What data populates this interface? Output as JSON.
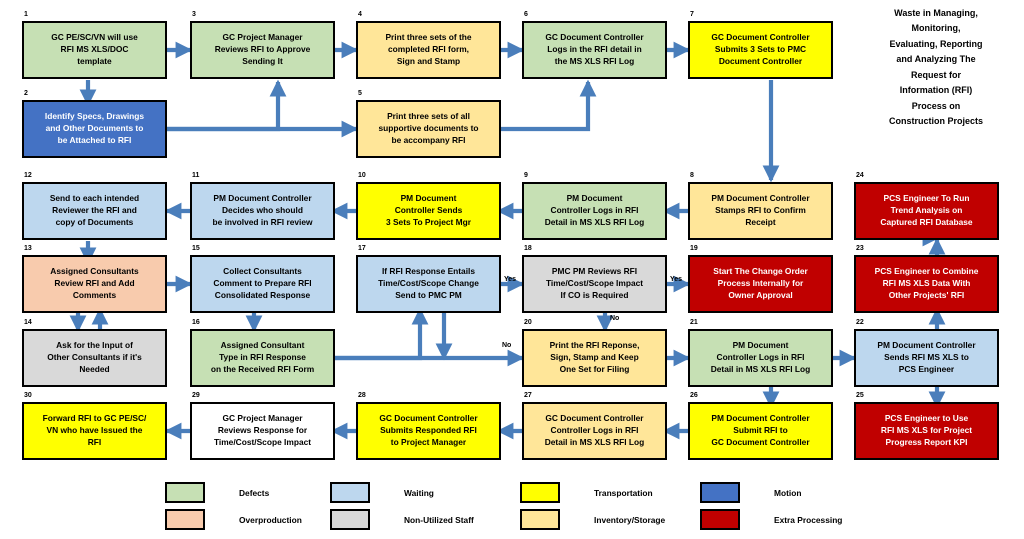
{
  "title": {
    "lines": [
      "Waste in Managing,",
      "Monitoring,",
      "Evaluating, Reporting",
      "and Analyzing The",
      "Request for",
      "Information (RFI)",
      "Process on",
      "Construction Projects"
    ]
  },
  "colors": {
    "defects": "#c6e0b4",
    "overproduction": "#f8cbad",
    "waiting": "#bdd7ee",
    "non_utilized_staff": "#d9d9d9",
    "transportation": "#ffff00",
    "inventory_storage": "#ffe699",
    "motion": "#4472c4",
    "extra_processing": "#c00000",
    "white": "#ffffff",
    "arrow": "#4a7ebb",
    "border": "#000000"
  },
  "nodes": [
    {
      "num": "1",
      "lines": [
        "GC PE/SC/VN will use",
        "RFI MS XLS/DOC",
        "template"
      ],
      "fill": "defects",
      "light": false
    },
    {
      "num": "2",
      "lines": [
        "Identify Specs, Drawings",
        "and Other Documents to",
        "be Attached to RFI"
      ],
      "fill": "motion",
      "light": true
    },
    {
      "num": "3",
      "lines": [
        "GC Project Manager",
        "Reviews RFI to Approve",
        "Sending It"
      ],
      "fill": "defects",
      "light": false
    },
    {
      "num": "4",
      "lines": [
        "Print three sets of the",
        "completed RFI form,",
        "Sign and Stamp"
      ],
      "fill": "inventory_storage",
      "light": false
    },
    {
      "num": "5",
      "lines": [
        "Print three sets of all",
        "supportive documents to",
        "be accompany RFI"
      ],
      "fill": "inventory_storage",
      "light": false
    },
    {
      "num": "6",
      "lines": [
        "GC Document Controller",
        "Logs in the RFI detail in",
        "the MS XLS RFI Log"
      ],
      "fill": "defects",
      "light": false
    },
    {
      "num": "7",
      "lines": [
        "GC Document Controller",
        "Submits 3 Sets to PMC",
        "Document Controller"
      ],
      "fill": "transportation",
      "light": false
    },
    {
      "num": "8",
      "lines": [
        "PM Document Controller",
        "Stamps RFI to Confirm",
        "Receipt"
      ],
      "fill": "inventory_storage",
      "light": false
    },
    {
      "num": "9",
      "lines": [
        "PM Document",
        "Controller Logs in RFI",
        "Detail in MS XLS RFI Log"
      ],
      "fill": "defects",
      "light": false
    },
    {
      "num": "10",
      "lines": [
        "PM Document",
        "Controller Sends",
        "3 Sets To Project Mgr"
      ],
      "fill": "transportation",
      "light": false
    },
    {
      "num": "11",
      "lines": [
        "PM Document Controller",
        "Decides who should",
        "be involved in RFI review"
      ],
      "fill": "waiting",
      "light": false
    },
    {
      "num": "12",
      "lines": [
        "Send to each intended",
        "Reviewer the RFI and",
        "copy of Documents"
      ],
      "fill": "waiting",
      "light": false
    },
    {
      "num": "13",
      "lines": [
        "Assigned Consultants",
        "Review RFI and Add",
        "Comments"
      ],
      "fill": "overproduction",
      "light": false
    },
    {
      "num": "14",
      "lines": [
        "Ask for the Input of",
        "Other Consultants if it's",
        "Needed"
      ],
      "fill": "non_utilized_staff",
      "light": false
    },
    {
      "num": "15",
      "lines": [
        "Collect Consultants",
        "Comment to Prepare RFI",
        "Consolidated Response"
      ],
      "fill": "waiting",
      "light": false
    },
    {
      "num": "16",
      "lines": [
        "Assigned Consultant",
        "Type in RFI Response",
        "on the Received RFI Form"
      ],
      "fill": "defects",
      "light": false
    },
    {
      "num": "17",
      "lines": [
        "If RFI Response Entails",
        "Time/Cost/Scope Change",
        "Send to PMC PM"
      ],
      "fill": "waiting",
      "light": false
    },
    {
      "num": "18",
      "lines": [
        "PMC PM Reviews RFI",
        "Time/Cost/Scope Impact",
        "If CO is Required"
      ],
      "fill": "non_utilized_staff",
      "light": false
    },
    {
      "num": "19",
      "lines": [
        "Start The Change Order",
        "Process Internally for",
        "Owner Approval"
      ],
      "fill": "extra_processing",
      "light": true
    },
    {
      "num": "20",
      "lines": [
        "Print the RFI Reponse,",
        "Sign, Stamp and Keep",
        "One Set for Filing"
      ],
      "fill": "inventory_storage",
      "light": false
    },
    {
      "num": "21",
      "lines": [
        "PM Document",
        "Controller Logs in RFI",
        "Detail in MS XLS RFI Log"
      ],
      "fill": "defects",
      "light": false
    },
    {
      "num": "22",
      "lines": [
        "PM Document Controller",
        "Sends RFI MS XLS to",
        "PCS Engineer"
      ],
      "fill": "waiting",
      "light": false
    },
    {
      "num": "23",
      "lines": [
        "PCS Engineer to Combine",
        "RFI MS XLS Data With",
        "Other Projects' RFI"
      ],
      "fill": "extra_processing",
      "light": true
    },
    {
      "num": "24",
      "lines": [
        "PCS Engineer To Run",
        "Trend Analysis on",
        "Captured RFI Database"
      ],
      "fill": "extra_processing",
      "light": true
    },
    {
      "num": "25",
      "lines": [
        "PCS Engineer to Use",
        "RFI MS XLS for Project",
        "Progress Report KPI"
      ],
      "fill": "extra_processing",
      "light": true
    },
    {
      "num": "26",
      "lines": [
        "PM Document Controller",
        "Submit RFI to",
        "GC Document Controller"
      ],
      "fill": "transportation",
      "light": false
    },
    {
      "num": "27",
      "lines": [
        "GC Document Controller",
        "Controller Logs in RFI",
        "Detail in MS XLS RFI Log"
      ],
      "fill": "inventory_storage",
      "light": false
    },
    {
      "num": "28",
      "lines": [
        "GC Document Controller",
        "Submits Responded RFI",
        "to Project Manager"
      ],
      "fill": "transportation",
      "light": false
    },
    {
      "num": "29",
      "lines": [
        "GC Project Manager",
        "Reviews Response for",
        "Time/Cost/Scope Impact"
      ],
      "fill": "white",
      "light": false
    },
    {
      "num": "30",
      "lines": [
        "Forward RFI to GC PE/SC/",
        "VN who have Issued the",
        "RFI"
      ],
      "fill": "transportation",
      "light": false
    }
  ],
  "edge_labels": [
    {
      "text": "Yes"
    },
    {
      "text": "Yes"
    },
    {
      "text": "No"
    },
    {
      "text": "No"
    }
  ],
  "legend": [
    {
      "label": "Defects",
      "fill": "defects"
    },
    {
      "label": "Overproduction",
      "fill": "overproduction"
    },
    {
      "label": "Waiting",
      "fill": "waiting"
    },
    {
      "label": "Non-Utilized Staff",
      "fill": "non_utilized_staff"
    },
    {
      "label": "Transportation",
      "fill": "transportation"
    },
    {
      "label": "Inventory/Storage",
      "fill": "inventory_storage"
    },
    {
      "label": "Motion",
      "fill": "motion"
    },
    {
      "label": "Extra Processing",
      "fill": "extra_processing"
    }
  ]
}
